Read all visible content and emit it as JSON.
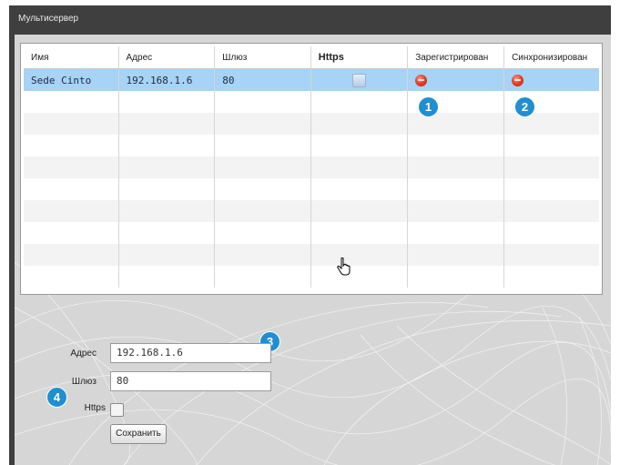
{
  "window": {
    "title": "Мультисервер"
  },
  "grid": {
    "columns": [
      "Имя",
      "Адрес",
      "Шлюз",
      "Https",
      "Зарегистрирован",
      "Синхронизирован"
    ],
    "rows": [
      {
        "name": "Sede Cinto",
        "address": "192.168.1.6",
        "gateway": "80",
        "https": false,
        "registered": "red",
        "synchronized": "red"
      }
    ]
  },
  "form": {
    "address_label": "Адрес",
    "address_value": "192.168.1.6",
    "gateway_label": "Шлюз",
    "gateway_value": "80",
    "https_label": "Https",
    "https_checked": false,
    "save_label": "Сохранить"
  },
  "callouts": [
    "1",
    "2",
    "3",
    "4"
  ],
  "colors": {
    "selection": "#a6d3f6",
    "callout": "#1f8fd1",
    "status_red": "#e8412b"
  }
}
